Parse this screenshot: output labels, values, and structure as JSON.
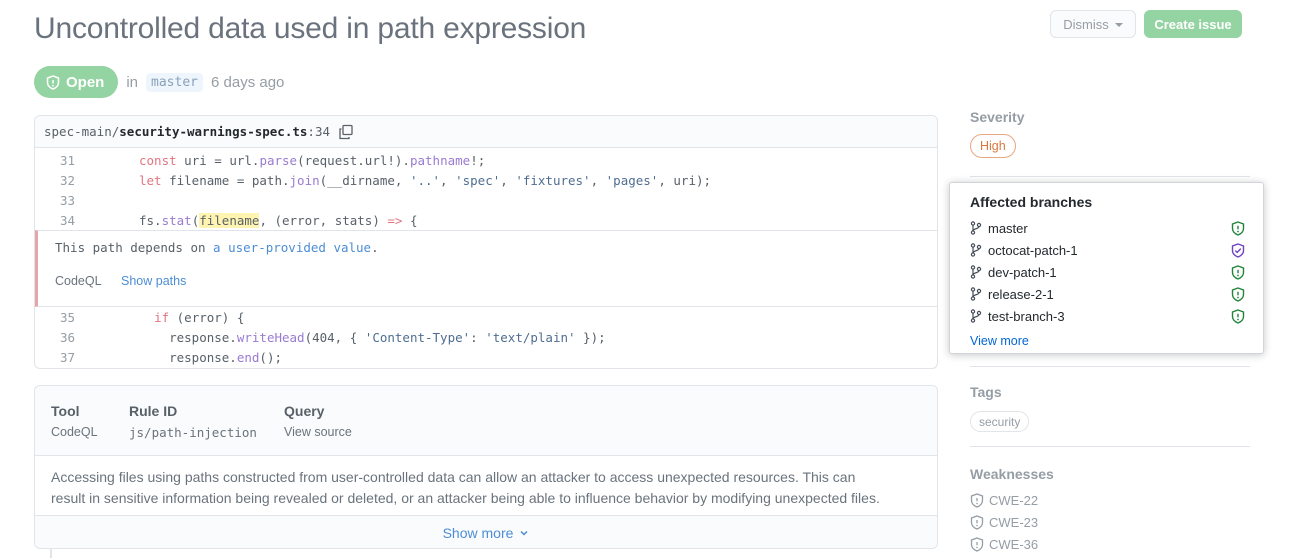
{
  "header": {
    "title": "Uncontrolled data used in path expression",
    "dismiss_label": "Dismiss",
    "create_issue_label": "Create issue"
  },
  "status": {
    "badge": "Open",
    "in_text": "in",
    "branch": "master",
    "age": "6 days ago"
  },
  "code": {
    "path_prefix": "spec-main/",
    "file": "security-warnings-spec.ts",
    "line_suffix": ":34",
    "line_numbers": [
      "31",
      "32",
      "33",
      "34",
      "35",
      "36",
      "37"
    ],
    "alert_message": "This path depends on",
    "alert_link": "a user-provided value",
    "alert_period": ".",
    "alert_tool": "CodeQL",
    "alert_show_paths": "Show paths"
  },
  "info": {
    "tool_header": "Tool",
    "tool_value": "CodeQL",
    "rule_header": "Rule ID",
    "rule_value": "js/path-injection",
    "query_header": "Query",
    "query_value": "View source",
    "description_line1": "Accessing files using paths constructed from user-controlled data can allow an attacker to access unexpected resources. This can",
    "description_line2": "result in sensitive information being revealed or deleted, or an attacker being able to influence behavior by modifying unexpected files.",
    "show_more": "Show more"
  },
  "sidebar": {
    "severity_title": "Severity",
    "severity_value": "High",
    "tags_title": "Tags",
    "tags": [
      "security"
    ],
    "weaknesses_title": "Weaknesses",
    "weaknesses": [
      "CWE-22",
      "CWE-23",
      "CWE-36"
    ]
  },
  "affected_branches": {
    "title": "Affected branches",
    "branches": [
      {
        "name": "master",
        "status_icon": "shield-alert-icon",
        "color": "#22863a"
      },
      {
        "name": "octocat-patch-1",
        "status_icon": "shield-check-icon",
        "color": "#6f42c1"
      },
      {
        "name": "dev-patch-1",
        "status_icon": "shield-alert-icon",
        "color": "#22863a"
      },
      {
        "name": "release-2-1",
        "status_icon": "shield-alert-icon",
        "color": "#22863a"
      },
      {
        "name": "test-branch-3",
        "status_icon": "shield-alert-icon",
        "color": "#22863a"
      }
    ],
    "view_more": "View more"
  },
  "colors": {
    "open_green": "#94d3a2",
    "link_blue": "#0366d6",
    "severity_orange": "#d9773d",
    "alert_red": "#e8a4a8"
  }
}
